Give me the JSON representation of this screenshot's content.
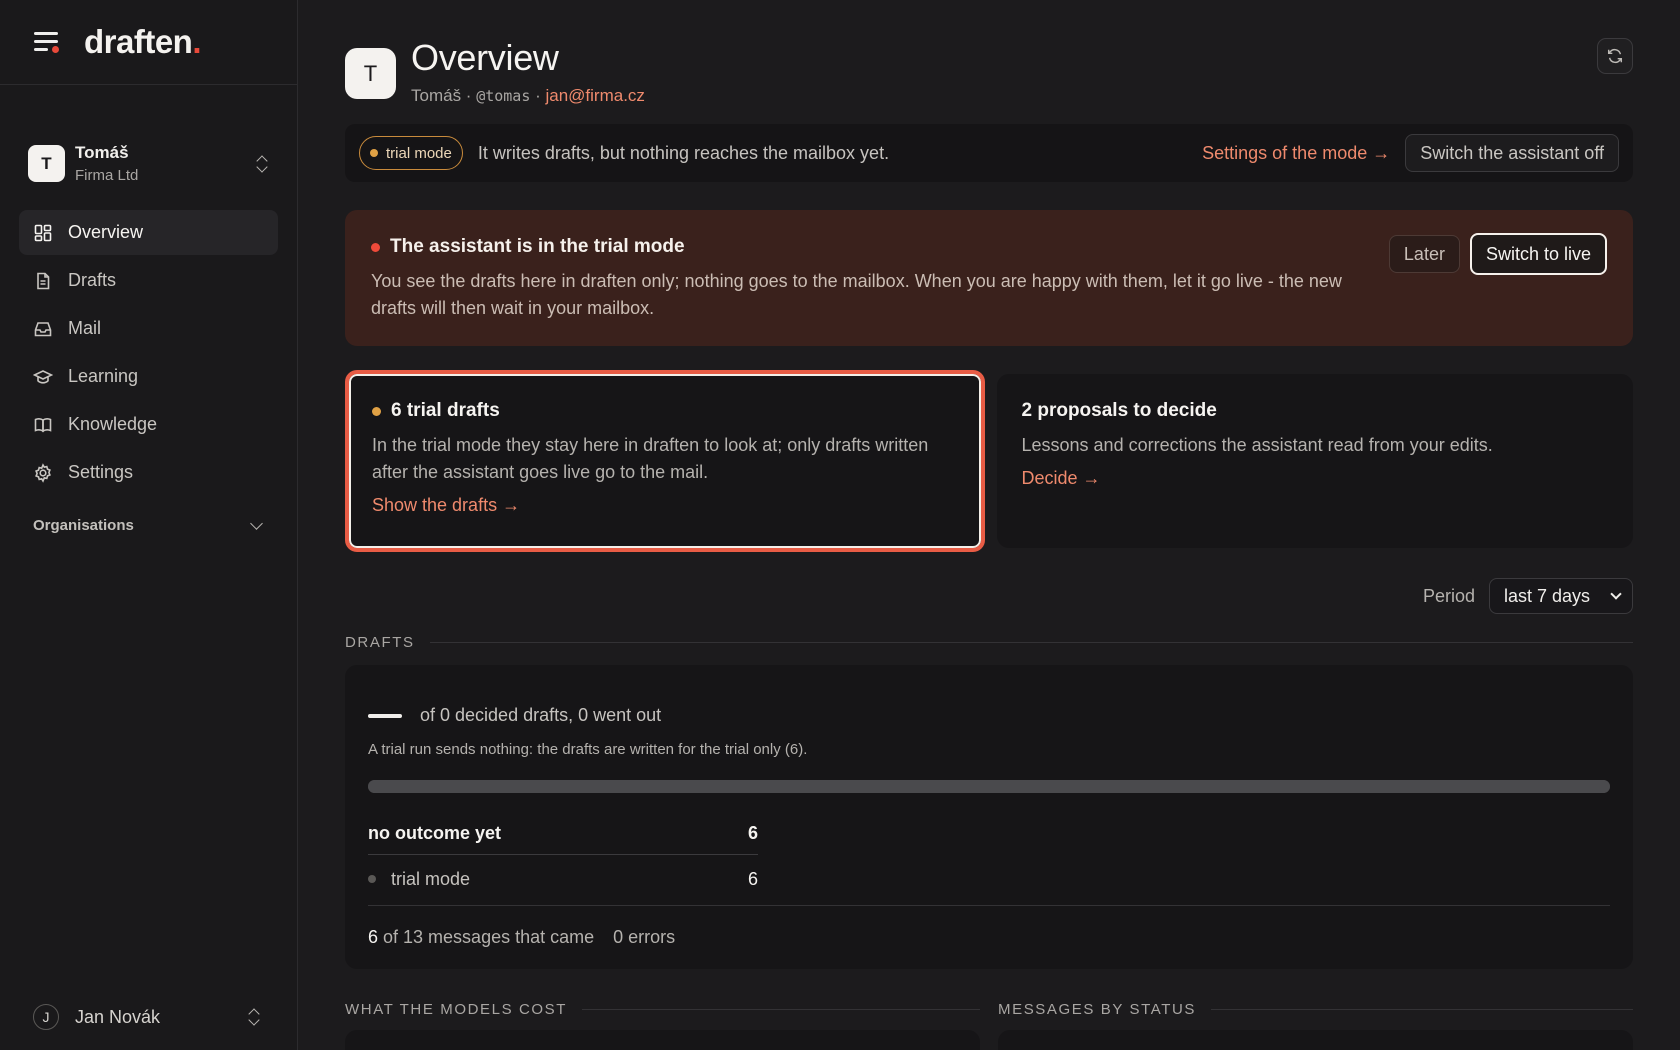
{
  "brand": {
    "name": "draften",
    "dot": "."
  },
  "account": {
    "initial": "T",
    "name": "Tomáš",
    "org": "Firma Ltd"
  },
  "nav": {
    "items": [
      {
        "label": "Overview",
        "icon": "grid-icon"
      },
      {
        "label": "Drafts",
        "icon": "document-icon"
      },
      {
        "label": "Mail",
        "icon": "inbox-icon"
      },
      {
        "label": "Learning",
        "icon": "graduation-cap-icon"
      },
      {
        "label": "Knowledge",
        "icon": "book-icon"
      },
      {
        "label": "Settings",
        "icon": "gear-icon"
      }
    ],
    "organisations_label": "Organisations"
  },
  "user": {
    "initial": "J",
    "name": "Jan Novák"
  },
  "header": {
    "initial": "T",
    "title": "Overview",
    "name": "Tomáš",
    "sep": " · ",
    "handle": "@tomas",
    "email": "jan@firma.cz"
  },
  "modebar": {
    "pill": "trial mode",
    "text": "It writes drafts, but nothing reaches the mailbox yet.",
    "settings_link": "Settings of the mode →",
    "switch_off": "Switch the assistant off"
  },
  "alert": {
    "title": "The assistant is in the trial mode",
    "body": "You see the drafts here in draften only; nothing goes to the mailbox. When you are happy with them, let it go live - the new drafts will then wait in your mailbox.",
    "later": "Later",
    "live": "Switch to live"
  },
  "cards": {
    "trial": {
      "title": "6 trial drafts",
      "body": "In the trial mode they stay here in draften to look at; only drafts written after the assistant goes live go to the mail.",
      "link": "Show the drafts →"
    },
    "proposals": {
      "title": "2 proposals to decide",
      "body": "Lessons and corrections the assistant read from your edits.",
      "link": "Decide →"
    }
  },
  "period": {
    "label": "Period",
    "value": "last 7 days"
  },
  "drafts": {
    "heading": "DRAFTS",
    "summary": "of 0 decided drafts, 0 went out",
    "note": "A trial run sends nothing: the drafts are written for the trial only (6).",
    "progress_fraction": 1.0,
    "table": {
      "head_label": "no outcome yet",
      "head_value": "6",
      "sub_label": "trial mode",
      "sub_value": "6"
    },
    "foot": {
      "count": "6",
      "of_text": "of 13 messages that came",
      "errors": "0 errors"
    }
  },
  "sections": {
    "models_cost": "WHAT THE MODELS COST",
    "by_status": "MESSAGES BY STATUS"
  },
  "colors": {
    "accent": "#ef8a6d",
    "trial": "#e0a145",
    "alert_dot": "#ef4a3a",
    "highlight": "#e85c45"
  }
}
